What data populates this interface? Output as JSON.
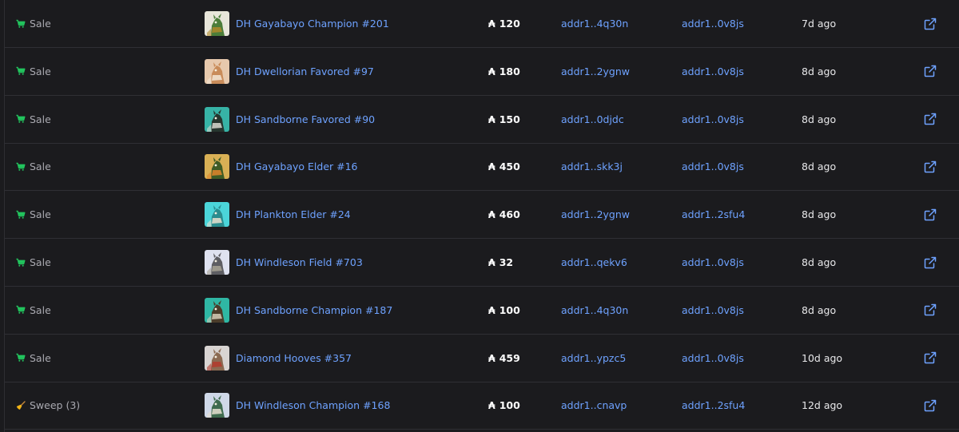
{
  "colors": {
    "background": "#1b1b1e",
    "link": "#6ea2ff",
    "sale_icon": "#22c55e",
    "sweep_icon": "#f2b416",
    "text_muted": "#a9a9b0"
  },
  "icons": {
    "sale": "cart-icon",
    "sweep": "broom-icon",
    "external": "external-link-icon"
  },
  "rows": [
    {
      "type": "Sale",
      "name": "DH Gayabayo Champion #201",
      "price": "120",
      "from": "addr1..4q30n",
      "to": "addr1..0v8js",
      "time": "7d ago",
      "thumb": {
        "bg": "#e8e6da",
        "skin": "#4c7d3a",
        "accent": "#b08a2c"
      }
    },
    {
      "type": "Sale",
      "name": "DH Dwellorian Favored #97",
      "price": "180",
      "from": "addr1..2ygnw",
      "to": "addr1..0v8js",
      "time": "8d ago",
      "thumb": {
        "bg": "#e7c9ad",
        "skin": "#c98c5a",
        "accent": "#f3e6d6"
      }
    },
    {
      "type": "Sale",
      "name": "DH Sandborne Favored #90",
      "price": "150",
      "from": "addr1..0djdc",
      "to": "addr1..0v8js",
      "time": "8d ago",
      "thumb": {
        "bg": "#37b3a6",
        "skin": "#26352e",
        "accent": "#d8d8d0"
      }
    },
    {
      "type": "Sale",
      "name": "DH Gayabayo Elder #16",
      "price": "450",
      "from": "addr1..skk3j",
      "to": "addr1..0v8js",
      "time": "8d ago",
      "thumb": {
        "bg": "#d9b055",
        "skin": "#3e5b25",
        "accent": "#e0862c"
      }
    },
    {
      "type": "Sale",
      "name": "DH Plankton Elder #24",
      "price": "460",
      "from": "addr1..2ygnw",
      "to": "addr1..2sfu4",
      "time": "8d ago",
      "thumb": {
        "bg": "#4bd5d9",
        "skin": "#2b8c8e",
        "accent": "#e9e1cf"
      }
    },
    {
      "type": "Sale",
      "name": "DH Windleson Field #703",
      "price": "32",
      "from": "addr1..qekv6",
      "to": "addr1..0v8js",
      "time": "8d ago",
      "thumb": {
        "bg": "#dfe2f0",
        "skin": "#5e5e63",
        "accent": "#a8a394"
      }
    },
    {
      "type": "Sale",
      "name": "DH Sandborne Champion #187",
      "price": "100",
      "from": "addr1..4q30n",
      "to": "addr1..0v8js",
      "time": "8d ago",
      "thumb": {
        "bg": "#2fb7a4",
        "skin": "#4b3c2a",
        "accent": "#d6cbb7"
      }
    },
    {
      "type": "Sale",
      "name": "Diamond Hooves #357",
      "price": "459",
      "from": "addr1..ypzc5",
      "to": "addr1..0v8js",
      "time": "10d ago",
      "thumb": {
        "bg": "#d8d4d2",
        "skin": "#8b6a52",
        "accent": "#b33a2d"
      }
    },
    {
      "type": "Sweep (3)",
      "name": "DH Windleson Champion #168",
      "price": "100",
      "from": "addr1..cnavp",
      "to": "addr1..2sfu4",
      "time": "12d ago",
      "thumb": {
        "bg": "#cfd8e8",
        "skin": "#3f6b4f",
        "accent": "#e6e0d0"
      }
    }
  ],
  "ada_symbol": "₳"
}
